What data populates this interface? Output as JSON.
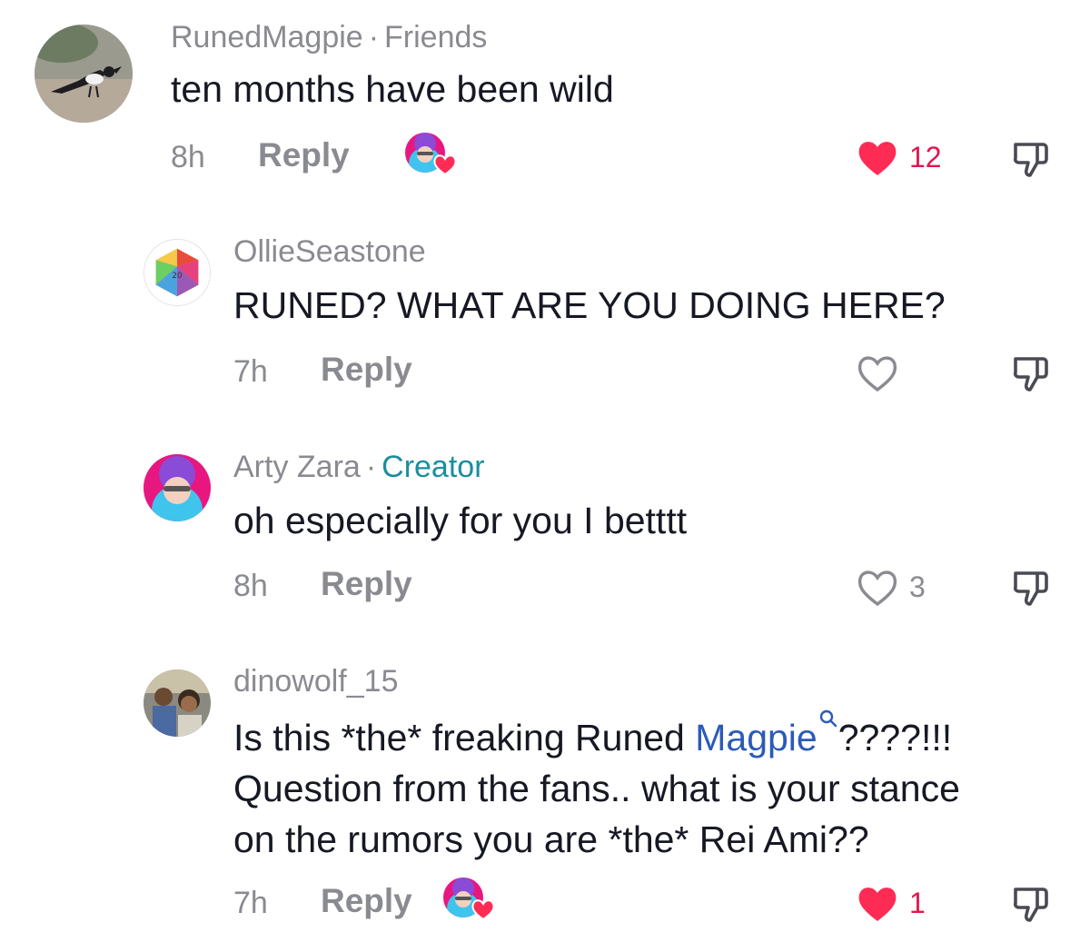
{
  "comments": [
    {
      "username": "RunedMagpie",
      "tag": "Friends",
      "text": "ten months have been wild",
      "time": "8h",
      "reply_label": "Reply",
      "liked_by_creator": true,
      "liked": true,
      "like_count": "12"
    },
    {
      "username": "OllieSeastone",
      "text": "RUNED? WHAT ARE YOU DOING HERE?",
      "time": "7h",
      "reply_label": "Reply",
      "liked": false,
      "like_count": ""
    },
    {
      "username": "Arty Zara",
      "tag": "Creator",
      "text": "oh especially for you I betttt",
      "time": "8h",
      "reply_label": "Reply",
      "liked": false,
      "like_count": "3"
    },
    {
      "username": "dinowolf_15",
      "text_line1_before": "Is this *the* freaking Runed ",
      "mention": "Magpie",
      "text_line1_after": "????!!!",
      "text_line2": "Question from the fans.. what is your stance",
      "text_line3": "on the rumors you are *the* Rei Ami??",
      "time": "7h",
      "reply_label": "Reply",
      "liked_by_creator": true,
      "liked": true,
      "like_count": "1"
    }
  ],
  "colors": {
    "like_red": "#e1164f",
    "meta_gray": "#8a8b91",
    "creator_teal": "#1a8e9e",
    "mention_blue": "#2b5bb8"
  },
  "icons": {
    "like": "heart-icon",
    "dislike": "thumbs-down-icon",
    "mention": "search-icon"
  }
}
